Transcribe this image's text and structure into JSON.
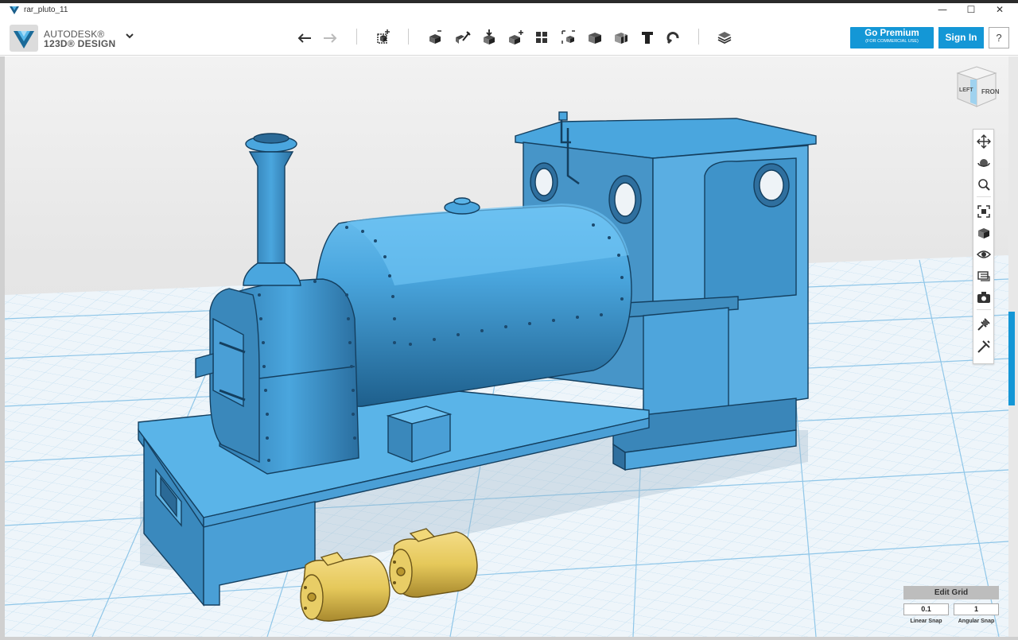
{
  "window": {
    "title": "rar_pluto_11",
    "minimize": "—",
    "maximize": "☐",
    "close": "✕"
  },
  "brand": {
    "line1": "AUTODESK®",
    "line2": "123D® DESIGN"
  },
  "toolbar": {
    "items": [
      "undo-icon",
      "redo-icon",
      "primitives-icon",
      "sketch-icon",
      "construct-icon",
      "modify-icon",
      "pattern-icon",
      "grouping-icon",
      "combine-icon",
      "measure-icon",
      "snap-icon",
      "text-icon",
      "magnet-icon",
      "materials-icon"
    ]
  },
  "header": {
    "premium_label": "Go Premium",
    "premium_sub": "(FOR COMMERCIAL USE)",
    "signin_label": "Sign In",
    "help_label": "?"
  },
  "viewcube": {
    "front": "FRONT",
    "left": "LEFT"
  },
  "nav": {
    "items": [
      "pan-icon",
      "orbit-icon",
      "zoom-icon",
      "fit-icon",
      "views-icon",
      "visibility-icon",
      "materials-outline-icon",
      "screenshot-icon",
      "snap-tool-icon",
      "brush-icon"
    ]
  },
  "grid": {
    "title": "Edit Grid",
    "linear_value": "0.1",
    "angular_value": "1",
    "linear_label": "Linear Snap",
    "angular_label": "Angular Snap"
  },
  "colors": {
    "accent": "#1497d6",
    "model_blue": "#3b8fc9",
    "part_yellow": "#e5c85a",
    "grid_line": "#8fc6e8"
  }
}
